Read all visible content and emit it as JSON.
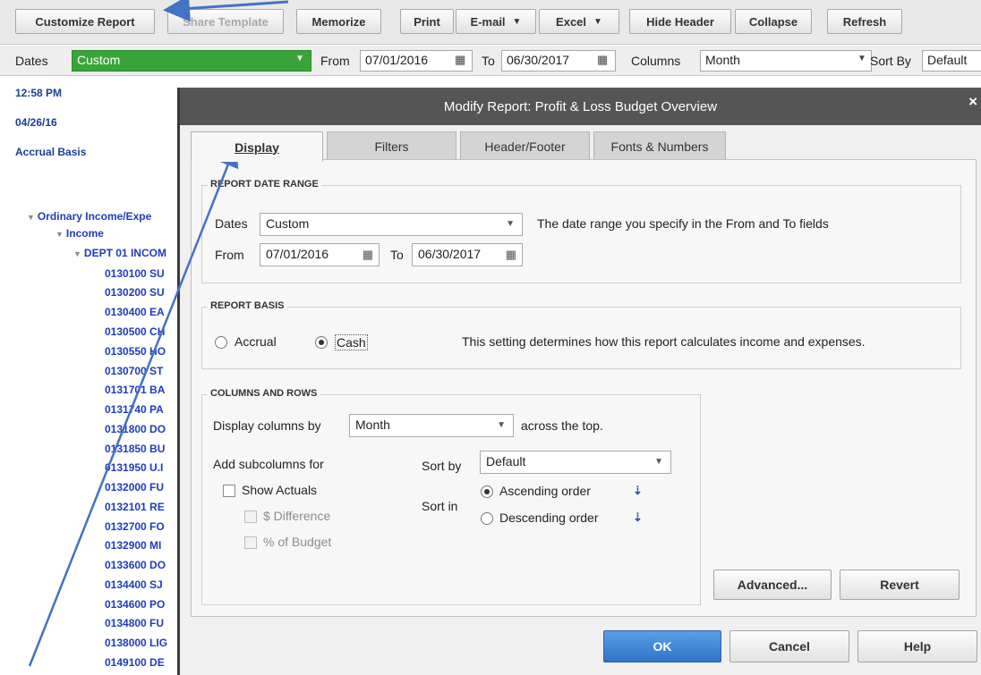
{
  "toolbar": {
    "customize": "Customize Report",
    "share": "Share Template",
    "memorize": "Memorize",
    "print": "Print",
    "email": "E-mail",
    "excel": "Excel",
    "hide_header": "Hide Header",
    "collapse": "Collapse",
    "refresh": "Refresh"
  },
  "filterbar": {
    "dates_label": "Dates",
    "dates_value": "Custom",
    "from_label": "From",
    "from_value": "07/01/2016",
    "to_label": "To",
    "to_value": "06/30/2017",
    "columns_label": "Columns",
    "columns_value": "Month",
    "sortby_label": "Sort By",
    "sortby_value": "Default"
  },
  "report": {
    "time": "12:58 PM",
    "date": "04/26/16",
    "basis": "Accrual Basis",
    "tree": [
      "Ordinary Income/Expe",
      "Income",
      "DEPT 01 INCOM"
    ],
    "accounts": [
      "0130100 SU",
      "0130200 SU",
      "0130400 EA",
      "0130500 CH",
      "0130550 HO",
      "0130700 ST",
      "0131701 BA",
      "0131740 PA",
      "0131800 DO",
      "0131850 BU",
      "0131950 U.I",
      "0132000 FU",
      "0132101 RE",
      "0132700 FO",
      "0132900 MI",
      "0133600 DO",
      "0134400 SJ",
      "0134600 PO",
      "0134800 FU",
      "0138000 LIG",
      "0149100 DE"
    ]
  },
  "dialog": {
    "title": "Modify Report: Profit & Loss Budget Overview",
    "close": "×",
    "tabs": [
      "Display",
      "Filters",
      "Header/Footer",
      "Fonts & Numbers"
    ],
    "date_range": {
      "title": "REPORT DATE RANGE",
      "dates_label": "Dates",
      "dates_value": "Custom",
      "hint": "The date range you specify in the From and To fields",
      "from_label": "From",
      "from_value": "07/01/2016",
      "to_label": "To",
      "to_value": "06/30/2017"
    },
    "basis": {
      "title": "REPORT BASIS",
      "accrual": "Accrual",
      "cash": "Cash",
      "selected": "Cash",
      "hint": "This setting determines how this report calculates income and expenses."
    },
    "columns": {
      "title": "COLUMNS AND ROWS",
      "display_label": "Display columns by",
      "display_value": "Month",
      "across": "across the top.",
      "subcolumns_label": "Add subcolumns for",
      "show_actuals": "Show Actuals",
      "diff": "$ Difference",
      "pct": "% of Budget",
      "sortby_label": "Sort by",
      "sortby_value": "Default",
      "sortin_label": "Sort in",
      "asc": "Ascending order",
      "desc": "Descending order"
    },
    "buttons": {
      "advanced": "Advanced...",
      "revert": "Revert",
      "ok": "OK",
      "cancel": "Cancel",
      "help": "Help"
    }
  },
  "colors": {
    "accent": "#4472c4",
    "dates_green": "#39a539",
    "report_text": "#1f3bbd"
  }
}
